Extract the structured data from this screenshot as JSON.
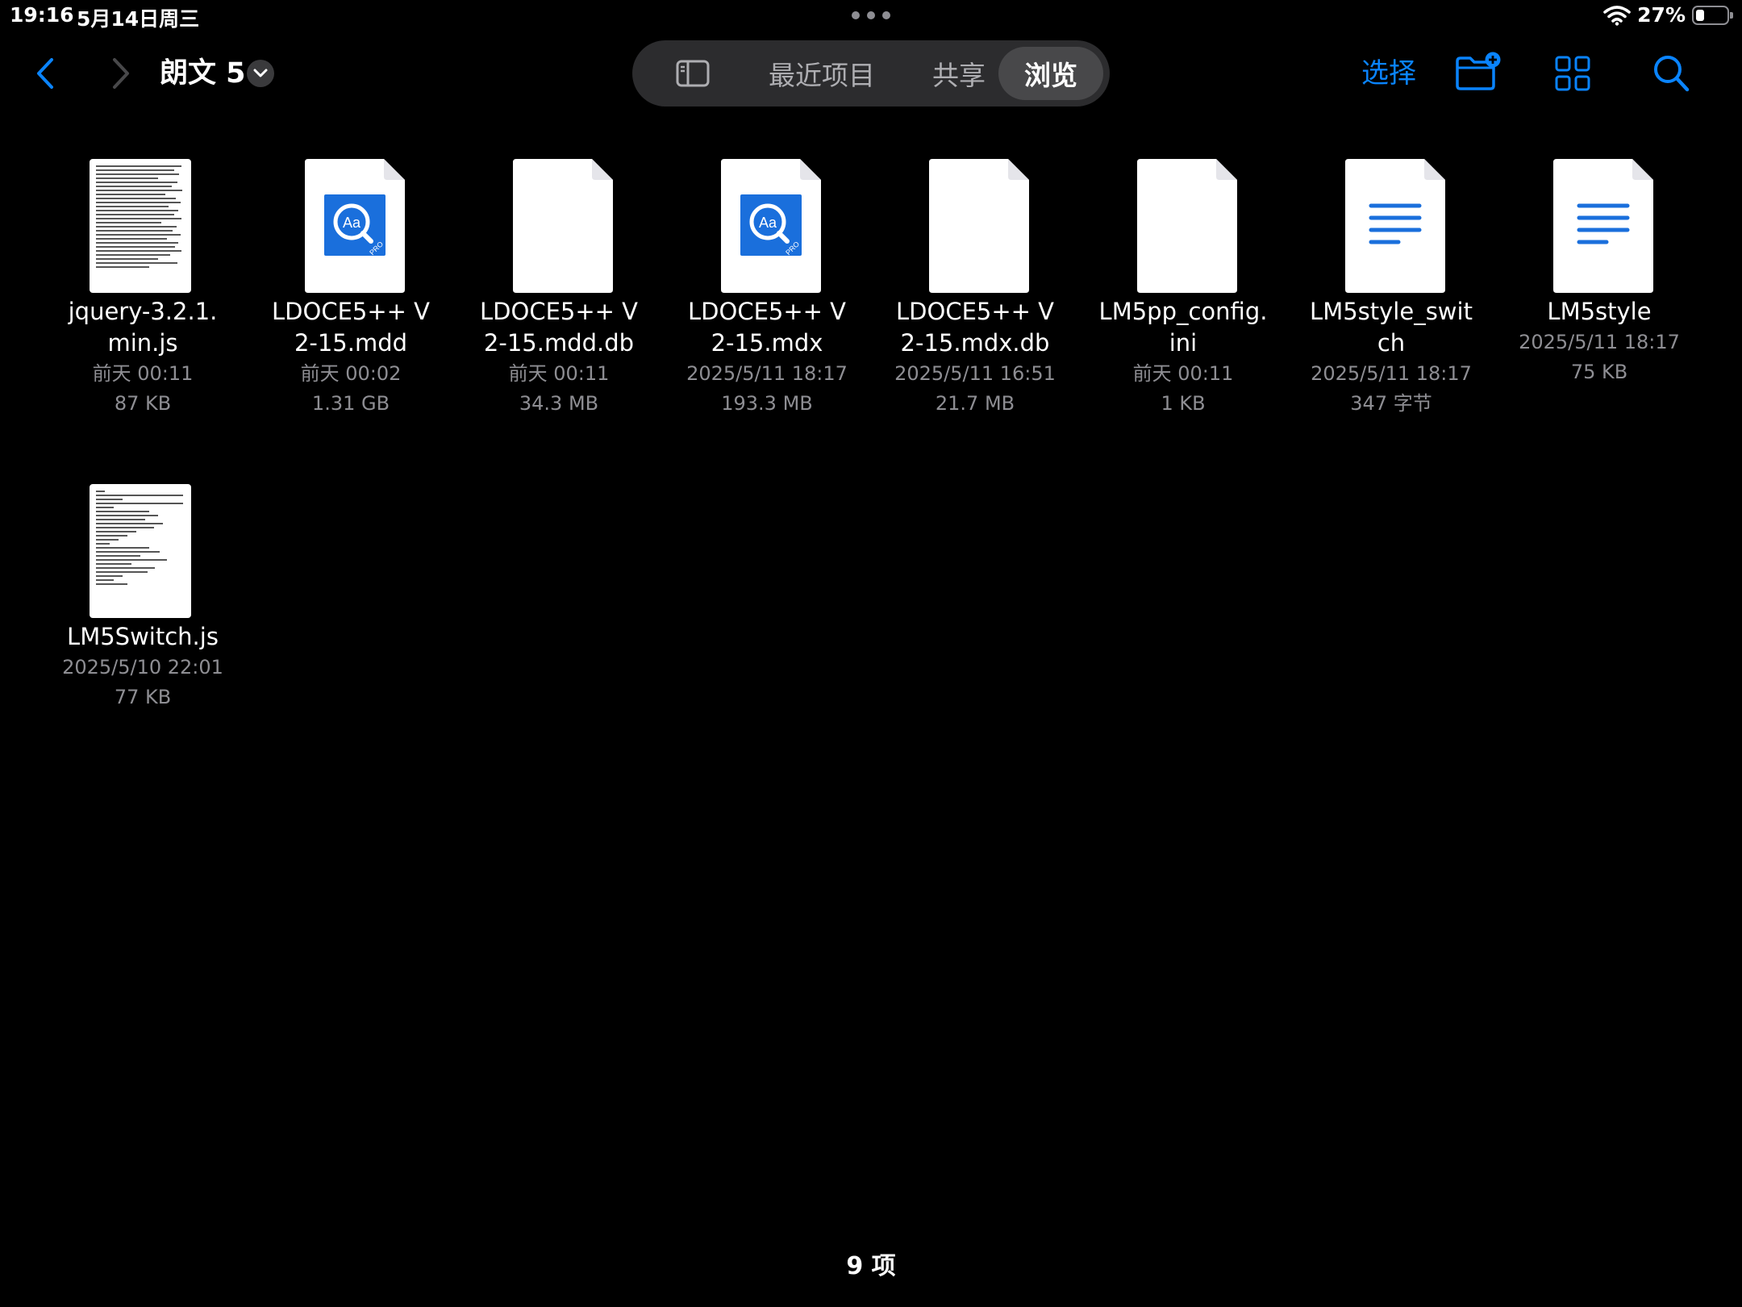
{
  "status_bar": {
    "time": "19:16",
    "date": "5月14日周三",
    "battery_percent": "27%",
    "battery_level": 0.27
  },
  "toolbar": {
    "folder_title": "朗文 5",
    "segments": {
      "recents": "最近项目",
      "shared": "共享",
      "browse": "浏览"
    },
    "select_label": "选择",
    "accent_color": "#0a84ff"
  },
  "files": [
    {
      "name": "jquery-3.2.1.min.js",
      "date": "前天 00:11",
      "size": "87 KB",
      "icon": "text-preview"
    },
    {
      "name": "LDOCE5++ V2-15.mdd",
      "date": "前天 00:02",
      "size": "1.31 GB",
      "icon": "dictionary-pro-icon"
    },
    {
      "name": "LDOCE5++ V2-15.mdd.db",
      "date": "前天 00:11",
      "size": "34.3 MB",
      "icon": "blank-document-icon"
    },
    {
      "name": "LDOCE5++ V2-15.mdx",
      "date": "2025/5/11 18:17",
      "size": "193.3 MB",
      "icon": "dictionary-pro-icon"
    },
    {
      "name": "LDOCE5++ V2-15.mdx.db",
      "date": "2025/5/11 16:51",
      "size": "21.7 MB",
      "icon": "blank-document-icon"
    },
    {
      "name": "LM5pp_config.ini",
      "date": "前天 00:11",
      "size": "1 KB",
      "icon": "blank-document-icon"
    },
    {
      "name": "LM5style_switch",
      "date": "2025/5/11 18:17",
      "size": "347 字节",
      "icon": "text-document-icon"
    },
    {
      "name": "LM5style",
      "date": "2025/5/11 18:17",
      "size": "75 KB",
      "icon": "text-document-icon"
    },
    {
      "name": "LM5Switch.js",
      "date": "2025/5/10 22:01",
      "size": "77 KB",
      "icon": "text-preview"
    }
  ],
  "footer": {
    "item_count": "9 项"
  }
}
